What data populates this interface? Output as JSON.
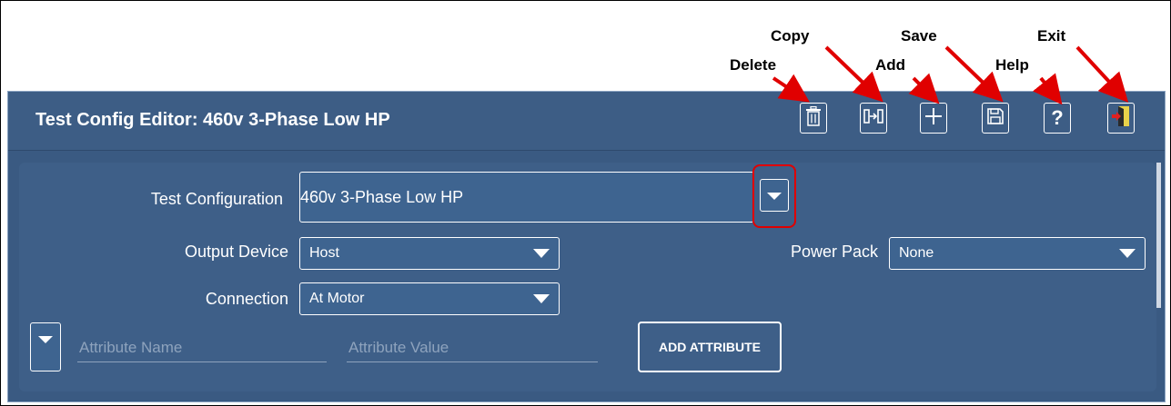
{
  "callouts": {
    "copy": "Copy",
    "delete": "Delete",
    "save": "Save",
    "add": "Add",
    "exit": "Exit",
    "help": "Help"
  },
  "header": {
    "title": "Test Config Editor: 460v 3-Phase Low HP"
  },
  "toolbar": {
    "icons": [
      "trash-icon",
      "copy-icon",
      "plus-icon",
      "floppy-disk-icon",
      "question-mark-icon",
      "exit-door-icon"
    ]
  },
  "form": {
    "test_configuration_label": "Test Configuration",
    "test_configuration_value": "460v 3-Phase Low HP",
    "output_device_label": "Output Device",
    "output_device_value": "Host",
    "power_pack_label": "Power Pack",
    "power_pack_value": "None",
    "connection_label": "Connection",
    "connection_value": "At Motor",
    "attribute_name_placeholder": "Attribute Name",
    "attribute_value_placeholder": "Attribute Value",
    "add_attribute_label": "ADD ATTRIBUTE"
  },
  "colors": {
    "panel": "#3e5f88",
    "titlebar": "#3d5d85",
    "callout_arrow": "#e00000",
    "highlight": "#e00000"
  }
}
